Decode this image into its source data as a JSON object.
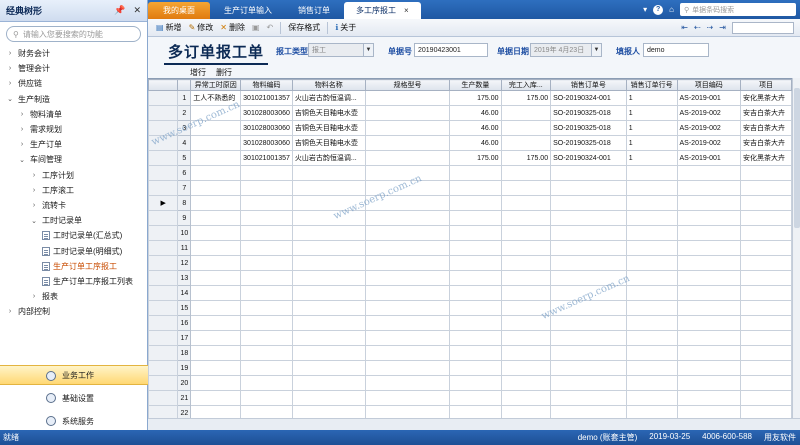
{
  "left_panel": {
    "title": "经典树形",
    "search_placeholder": "请输入您要搜索的功能",
    "tree": [
      {
        "label": "财务会计",
        "level": 0,
        "arrow": "›"
      },
      {
        "label": "管理会计",
        "level": 0,
        "arrow": "›"
      },
      {
        "label": "供应链",
        "level": 0,
        "arrow": "›"
      },
      {
        "label": "生产制造",
        "level": 0,
        "arrow": "⌄"
      },
      {
        "label": "物料清单",
        "level": 1,
        "arrow": "›"
      },
      {
        "label": "需求规划",
        "level": 1,
        "arrow": "›"
      },
      {
        "label": "生产订单",
        "level": 1,
        "arrow": "›"
      },
      {
        "label": "车间管理",
        "level": 1,
        "arrow": "⌄"
      },
      {
        "label": "工序计划",
        "level": 2,
        "arrow": "›"
      },
      {
        "label": "工序滚工",
        "level": 2,
        "arrow": "›"
      },
      {
        "label": "流转卡",
        "level": 2,
        "arrow": "›"
      },
      {
        "label": "工时记录单",
        "level": 2,
        "arrow": "⌄"
      },
      {
        "label": "工时记录单(汇总式)",
        "level": 3,
        "doc": true
      },
      {
        "label": "工时记录单(明细式)",
        "level": 3,
        "doc": true
      },
      {
        "label": "生产订单工序报工",
        "level": 3,
        "doc": true,
        "selected": true
      },
      {
        "label": "生产订单工序报工列表",
        "level": 3,
        "doc": true
      },
      {
        "label": "报表",
        "level": 2,
        "arrow": "›"
      },
      {
        "label": "内部控制",
        "level": 0,
        "arrow": "›"
      }
    ],
    "bottom_nav": [
      {
        "label": "业务工作",
        "active": true
      },
      {
        "label": "基础设置",
        "active": false
      },
      {
        "label": "系统服务",
        "active": false
      }
    ]
  },
  "tabs": [
    {
      "label": "我的桌面",
      "kind": "home"
    },
    {
      "label": "生产订单输入",
      "kind": "normal"
    },
    {
      "label": "销售订单",
      "kind": "normal"
    },
    {
      "label": "多工序报工",
      "kind": "active",
      "close": "×"
    }
  ],
  "topbar": {
    "dropdown": "▾",
    "help": "?",
    "home_glyph": "⌂",
    "search_placeholder": "单据条码搜索"
  },
  "toolbar": {
    "new": "新增",
    "modify": "修改",
    "delete": "删除",
    "save_format": "保存格式",
    "close": "关于"
  },
  "form": {
    "title": "多订单报工单",
    "report_type_label": "报工类型",
    "report_type_value": "报工",
    "doc_no_label": "单据号",
    "doc_no_value": "20190423001",
    "doc_date_label": "单据日期",
    "doc_date_value": "2019年 4月23日",
    "reporter_label": "填报人",
    "reporter_value": "demo"
  },
  "row_ops": {
    "add": "增行",
    "delete": "删行"
  },
  "grid": {
    "headers": [
      "",
      "异常工时原因",
      "物料编码",
      "物料名称",
      "规格型号",
      "生产数量",
      "完工入库...",
      "销售订单号",
      "销售订单行号",
      "项目编码",
      "项目"
    ],
    "rows": [
      {
        "n": "1",
        "cells": [
          "工人不熟悉的",
          "301021001357",
          "火山岩古韵恒温调...",
          "",
          "175.00",
          "175.00",
          "SO-20190324-001",
          "1",
          "AS-2019-001",
          "安化黑茶大卉"
        ]
      },
      {
        "n": "2",
        "cells": [
          "",
          "301028003060",
          "吉铜色天目釉电水壶",
          "",
          "46.00",
          "",
          "SO-20190325-018",
          "1",
          "AS-2019-002",
          "安吉白茶大卉"
        ]
      },
      {
        "n": "3",
        "cells": [
          "",
          "301028003060",
          "吉铜色天目釉电水壶",
          "",
          "46.00",
          "",
          "SO-20190325-018",
          "1",
          "AS-2019-002",
          "安吉白茶大卉"
        ]
      },
      {
        "n": "4",
        "cells": [
          "",
          "301028003060",
          "吉铜色天目釉电水壶",
          "",
          "46.00",
          "",
          "SO-20190325-018",
          "1",
          "AS-2019-002",
          "安吉白茶大卉"
        ]
      },
      {
        "n": "5",
        "cells": [
          "",
          "301021001357",
          "火山岩古韵恒温调...",
          "",
          "175.00",
          "175.00",
          "SO-20190324-001",
          "1",
          "AS-2019-001",
          "安化黑茶大卉"
        ]
      },
      {
        "n": "6",
        "cells": [
          "",
          "",
          "",
          "",
          "",
          "",
          "",
          "",
          "",
          ""
        ]
      },
      {
        "n": "7",
        "cells": [
          "",
          "",
          "",
          "",
          "",
          "",
          "",
          "",
          "",
          ""
        ]
      },
      {
        "n": "8",
        "cells": [
          "",
          "",
          "",
          "",
          "",
          "",
          "",
          "",
          "",
          ""
        ]
      },
      {
        "n": "9",
        "cells": [
          "",
          "",
          "",
          "",
          "",
          "",
          "",
          "",
          "",
          ""
        ]
      },
      {
        "n": "10",
        "cells": [
          "",
          "",
          "",
          "",
          "",
          "",
          "",
          "",
          "",
          ""
        ]
      },
      {
        "n": "11",
        "cells": [
          "",
          "",
          "",
          "",
          "",
          "",
          "",
          "",
          "",
          ""
        ]
      },
      {
        "n": "12",
        "cells": [
          "",
          "",
          "",
          "",
          "",
          "",
          "",
          "",
          "",
          ""
        ]
      },
      {
        "n": "13",
        "cells": [
          "",
          "",
          "",
          "",
          "",
          "",
          "",
          "",
          "",
          ""
        ]
      },
      {
        "n": "14",
        "cells": [
          "",
          "",
          "",
          "",
          "",
          "",
          "",
          "",
          "",
          ""
        ]
      },
      {
        "n": "15",
        "cells": [
          "",
          "",
          "",
          "",
          "",
          "",
          "",
          "",
          "",
          ""
        ]
      },
      {
        "n": "16",
        "cells": [
          "",
          "",
          "",
          "",
          "",
          "",
          "",
          "",
          "",
          ""
        ]
      },
      {
        "n": "17",
        "cells": [
          "",
          "",
          "",
          "",
          "",
          "",
          "",
          "",
          "",
          ""
        ]
      },
      {
        "n": "18",
        "cells": [
          "",
          "",
          "",
          "",
          "",
          "",
          "",
          "",
          "",
          ""
        ]
      },
      {
        "n": "19",
        "cells": [
          "",
          "",
          "",
          "",
          "",
          "",
          "",
          "",
          "",
          ""
        ]
      },
      {
        "n": "20",
        "cells": [
          "",
          "",
          "",
          "",
          "",
          "",
          "",
          "",
          "",
          ""
        ]
      },
      {
        "n": "21",
        "cells": [
          "",
          "",
          "",
          "",
          "",
          "",
          "",
          "",
          "",
          ""
        ]
      },
      {
        "n": "22",
        "cells": [
          "",
          "",
          "",
          "",
          "",
          "",
          "",
          "",
          "",
          ""
        ]
      }
    ],
    "current_row_marker": "▶",
    "current_row": 8
  },
  "watermark": "www.soerp.com.cn",
  "status": {
    "left": "就绪",
    "user": "demo (账套主管)",
    "date": "2019-03-25",
    "phone": "4006-600-588",
    "vendor": "用友软件"
  }
}
